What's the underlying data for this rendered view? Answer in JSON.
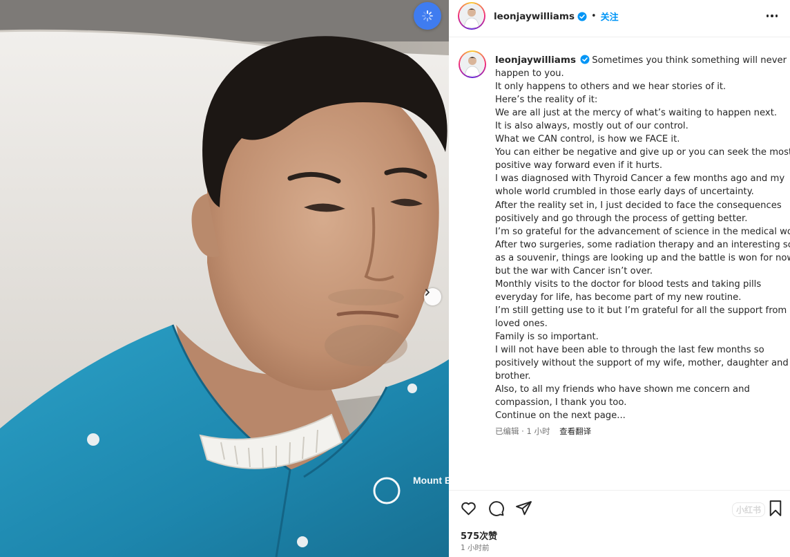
{
  "post": {
    "username": "leonjaywilliams",
    "follow_label": "关注",
    "separator": "•",
    "more_icon": "ellipsis-icon",
    "verified_icon": "verified-badge-icon"
  },
  "caption": {
    "username": "leonjaywilliams",
    "first_line": "Sometimes you think something will never",
    "lines": [
      "happen to you.",
      "It only happens to others and we hear stories of it.",
      "Here’s the reality of it:",
      "We are all just at the mercy of what’s waiting to happen next.",
      "It is also always, mostly out of our control.",
      "What we CAN control, is how we FACE it.",
      "You can either be negative and give up or you can seek the most",
      "positive way forward even if it hurts.",
      "I was diagnosed with Thyroid Cancer a few months ago and my",
      "whole world crumbled in those early days of uncertainty.",
      "After the reality set in, I just decided to face the consequences",
      "positively and go through the process of getting better.",
      "I’m so grateful for the advancement of science in the medical world.",
      "After two surgeries, some radiation therapy and an interesting scar",
      "as a souvenir, things are looking up and the battle is won for now,",
      "but the war with Cancer isn’t over.",
      "Monthly visits to the doctor for blood tests and taking pills",
      "everyday for life, has become part of my new routine.",
      "I’m still getting use to it but I’m grateful for all the support from my",
      "loved ones.",
      "Family is so important.",
      "I will not have been able to through the last few months so",
      "positively without the support of my wife, mother, daughter and",
      "brother.",
      "Also, to all my friends who have shown me concern and",
      "compassion, I thank you too.",
      "Continue on the next page..."
    ],
    "edited": "已编辑 · 1 小时",
    "translate_label": "查看翻译"
  },
  "actions": {
    "like_icon": "heart-icon",
    "comment_icon": "comment-icon",
    "share_icon": "send-icon",
    "save_icon": "bookmark-icon",
    "likes": "575次赞",
    "time": "1 小时前",
    "watermark": "小红书"
  },
  "media": {
    "next_icon": "chevron-right-icon",
    "loader_icon": "loading-spinner-icon",
    "shirt_logo": "Mount E ORCHARD",
    "colors": {
      "shirt": "#1f8fb5",
      "pillow": "#e9e6e2",
      "skin": "#c99c7e",
      "accent": "#0095f6",
      "spinner_bg": "#3f7cf0"
    }
  }
}
